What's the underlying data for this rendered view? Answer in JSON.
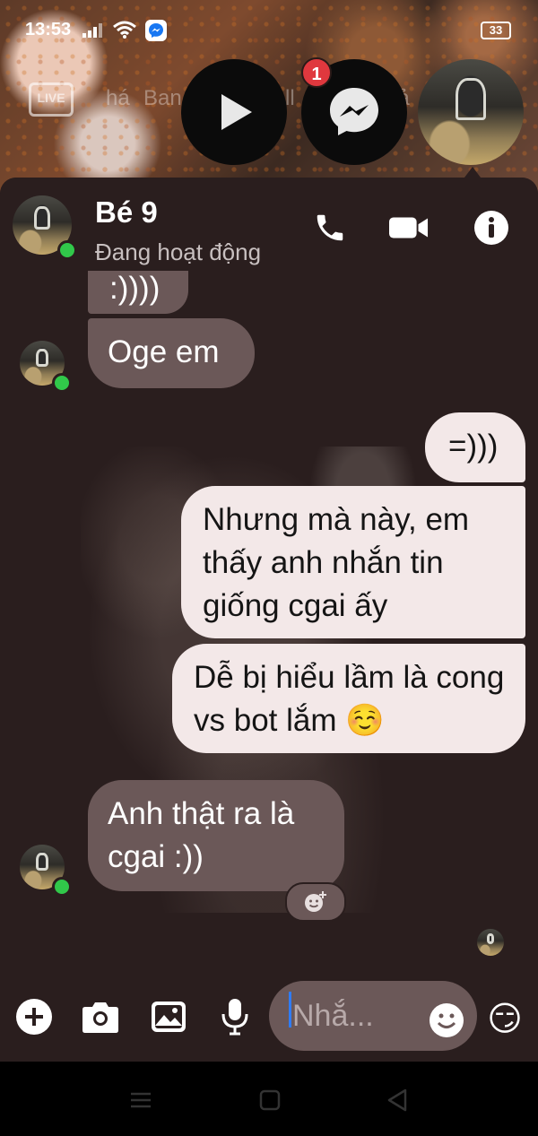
{
  "status_bar": {
    "time": "13:53",
    "battery": "33"
  },
  "background_video": {
    "live_label": "LIVE",
    "text_a": "há",
    "text_b": "Ban",
    "text_c": "ll",
    "text_d": "uả"
  },
  "chat_heads": {
    "unread_count": "1",
    "play_icon": "play-icon",
    "messenger_icon": "messenger-icon"
  },
  "header": {
    "name": "Bé 9",
    "status": "Đang hoạt động",
    "call_icon": "phone-icon",
    "video_icon": "video-camera-icon",
    "info_icon": "info-icon"
  },
  "messages": [
    {
      "side": "in",
      "text": ":))))"
    },
    {
      "side": "in",
      "text": "Oge em"
    },
    {
      "side": "out",
      "text": "=)))"
    },
    {
      "side": "out",
      "text": "Nhưng mà này, em thấy anh nhắn tin giống cgai ấy"
    },
    {
      "side": "out",
      "text": "Dễ bị hiểu lầm là cong vs bot lắm ☺️"
    },
    {
      "side": "in",
      "text": "Anh thật ra là cgai :))"
    }
  ],
  "composer": {
    "placeholder": "Nhắ...",
    "add_icon": "plus-circle-icon",
    "camera_icon": "camera-icon",
    "gallery_icon": "image-icon",
    "mic_icon": "microphone-icon",
    "emoji_icon": "smiley-icon",
    "quick_reaction": "😏"
  },
  "colors": {
    "panel_bg": "#2a1e1e",
    "incoming_bubble": "#6b5858",
    "outgoing_bubble": "#f3e8e8",
    "online": "#31c84a",
    "badge": "#e0383e"
  }
}
